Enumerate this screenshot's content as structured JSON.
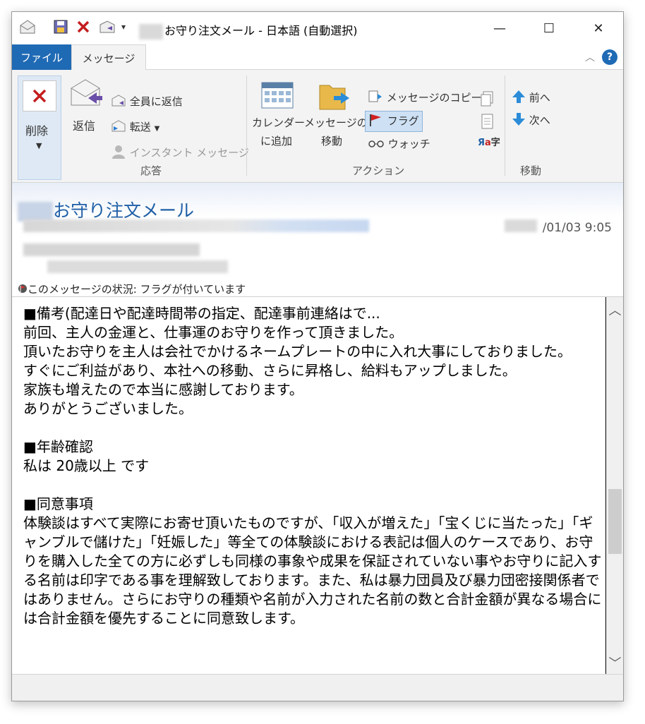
{
  "window": {
    "title": "お守り注文メール - 日本語 (自動選択)",
    "minimize_label": "—",
    "maximize_label": "☐",
    "close_label": "✕"
  },
  "tabs": {
    "file": "ファイル",
    "message": "メッセージ"
  },
  "ribbon": {
    "delete": "削除",
    "reply": "返信",
    "reply_all": "全員に返信",
    "forward": "転送",
    "instant_message": "インスタント メッセージ",
    "group_respond": "応答",
    "add_to_calendar_line1": "カレンダー",
    "add_to_calendar_line2": "に追加",
    "move_message_line1": "メッセージの",
    "move_message_line2": "移動",
    "copy_message": "メッセージのコピー",
    "flag": "フラグ",
    "watch": "ウォッチ",
    "group_actions": "アクション",
    "prev": "前へ",
    "next": "次へ",
    "group_move": "移動"
  },
  "header": {
    "subject": "お守り注文メール",
    "date": "/01/03 9:05",
    "status": "このメッセージの状況: フラグが付いています"
  },
  "body": {
    "text": "■備考(配達日や配達時間帯の指定、配達事前連絡はで...\n前回、主人の金運と、仕事運のお守りを作って頂きました。\n頂いたお守りを主人は会社でかけるネームプレートの中に入れ大事にしておりました。\nすぐにご利益があり、本社への移動、さらに昇格し、給料もアップしました。\n家族も増えたので本当に感謝しております。\nありがとうございました。\n\n■年齢確認\n私は 20歳以上 です\n\n■同意事項\n体験談はすべて実際にお寄せ頂いたものですが、「収入が増えた」「宝くじに当たった」「ギャンブルで儲けた」「妊娠した」等全ての体験談における表記は個人のケースであり、お守りを購入した全ての方に必ずしも同様の事象や成果を保証されていない事やお守りに記入する名前は印字である事を理解致しております。また、私は暴力団員及び暴力団密接関係者ではありません。さらにお守りの種類や名前が入力された名前の数と合計金額が異なる場合には合計金額を優先することに同意致します。"
  },
  "colors": {
    "accent": "#1f6ab5",
    "subject": "#1f5fa6"
  }
}
